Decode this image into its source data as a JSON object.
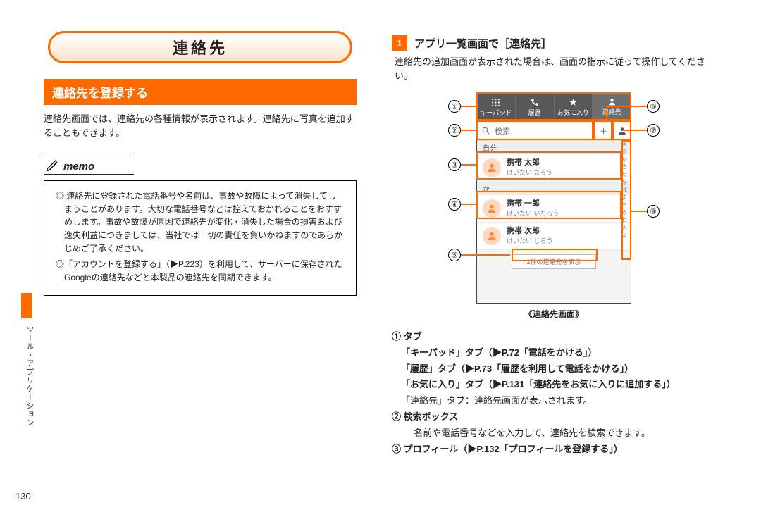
{
  "side_label": "ツール・アプリケーション",
  "page_number": "130",
  "left": {
    "title": "連絡先",
    "section": "連絡先を登録する",
    "lead": "連絡先画面では、連絡先の各種情報が表示されます。連絡先に写真を追加することもできます。",
    "memo_label": "memo",
    "memo1": "◎ 連絡先に登録された電話番号や名前は、事故や故障によって消失してしまうことがあります。大切な電話番号などは控えておかれることをおすすめします。事故や故障が原因で連絡先が変化・消失した場合の損害および逸失利益につきましては、当社では一切の責任を負いかねますのであらかじめご了承ください。",
    "memo2": "◎「アカウントを登録する」（▶P.223）を利用して、サーバーに保存されたGoogleの連絡先などと本製品の連絡先を同期できます。"
  },
  "right": {
    "step_num": "1",
    "step_title": "アプリ一覧画面で［連絡先］",
    "step_note": "連絡先の追加画面が表示された場合は、画面の指示に従って操作してください。",
    "phone": {
      "tabs": [
        "キーパッド",
        "履歴",
        "お気に入り",
        "連絡先"
      ],
      "search_placeholder": "検索",
      "group1": "自分",
      "contact1_name": "携帯 太郎",
      "contact1_kana": "けいたい たろう",
      "group2": "か",
      "contact2_name": "携帯 一郎",
      "contact2_kana": "けいたい いちろう",
      "contact3_name": "携帯 次郎",
      "contact3_kana": "けいたい じろう",
      "more": "2件の連絡先を表示",
      "index": "★ あ か さ た な は ま や ら わ A #"
    },
    "fig_caption": "《連絡先画面》",
    "callouts": {
      "c1": "①",
      "c2": "②",
      "c3": "③",
      "c4": "④",
      "c5": "⑤",
      "c6": "⑥",
      "c7": "⑦",
      "c8": "⑧"
    },
    "d1_head": "① タブ",
    "d1a": "「キーパッド」タブ（▶P.72「電話をかける」）",
    "d1b": "「履歴」タブ（▶P.73「履歴を利用して電話をかける」）",
    "d1c": "「お気に入り」タブ（▶P.131「連絡先をお気に入りに追加する」）",
    "d1d": "「連絡先」タブ：連絡先画面が表示されます。",
    "d2_head": "② 検索ボックス",
    "d2": "名前や電話番号などを入力して、連絡先を検索できます。",
    "d3_head": "③ プロフィール（▶P.132「プロフィールを登録する」）"
  }
}
